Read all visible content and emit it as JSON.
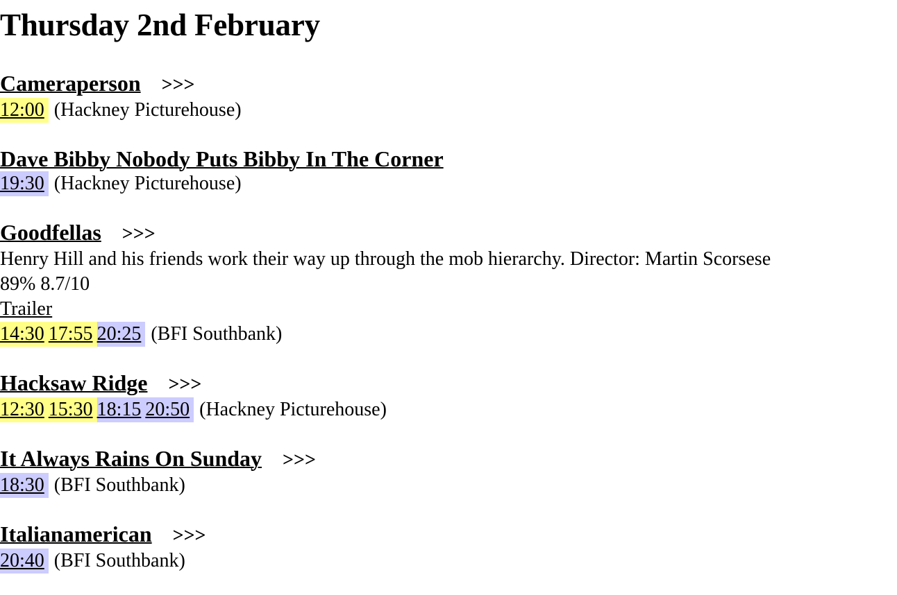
{
  "page": {
    "heading": "Thursday 2nd February",
    "more_label": ">>>"
  },
  "colors": {
    "matinee_highlight": "#ffff88",
    "evening_highlight": "#ccccff",
    "text": "#000000",
    "background": "#ffffff"
  },
  "films": [
    {
      "title": "Cameraperson",
      "has_more": true,
      "times": [
        {
          "time": "12:00",
          "period": "matinee"
        }
      ],
      "venue": "(Hackney Picturehouse)"
    },
    {
      "title": "Dave Bibby Nobody Puts Bibby In The Corner",
      "has_more": false,
      "times": [
        {
          "time": "19:30",
          "period": "evening"
        }
      ],
      "venue": "(Hackney Picturehouse)"
    },
    {
      "title": "Goodfellas",
      "has_more": true,
      "description": "Henry Hill and his friends work their way up through the mob hierarchy. Director: Martin Scorsese",
      "ratings": "89% 8.7/10",
      "trailer_label": "Trailer",
      "times": [
        {
          "time": "14:30",
          "period": "matinee"
        },
        {
          "time": "17:55",
          "period": "matinee"
        },
        {
          "time": "20:25",
          "period": "evening"
        }
      ],
      "venue": "(BFI Southbank)"
    },
    {
      "title": "Hacksaw Ridge",
      "has_more": true,
      "times": [
        {
          "time": "12:30",
          "period": "matinee"
        },
        {
          "time": "15:30",
          "period": "matinee"
        },
        {
          "time": "18:15",
          "period": "evening"
        },
        {
          "time": "20:50",
          "period": "evening"
        }
      ],
      "venue": "(Hackney Picturehouse)"
    },
    {
      "title": "It Always Rains On Sunday",
      "has_more": true,
      "times": [
        {
          "time": "18:30",
          "period": "evening"
        }
      ],
      "venue": "(BFI Southbank)"
    },
    {
      "title": "Italianamerican",
      "has_more": true,
      "times": [
        {
          "time": "20:40",
          "period": "evening"
        }
      ],
      "venue": "(BFI Southbank)"
    }
  ]
}
